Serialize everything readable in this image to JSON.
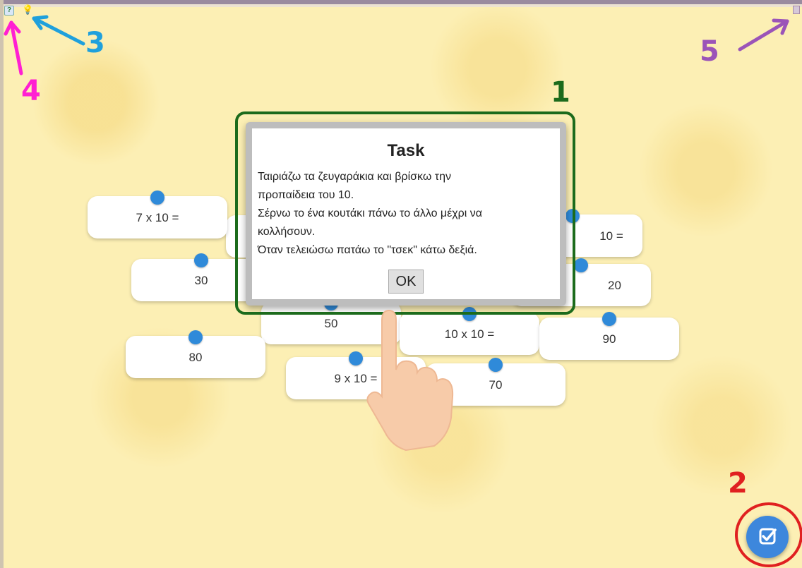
{
  "app": {
    "toolbar_icons": [
      "question-mark-icon",
      "lightbulb-icon"
    ],
    "help_glyph": "?",
    "hint_glyph": "💡"
  },
  "cards": [
    {
      "label": "7 x 10 ="
    },
    {
      "label": "30"
    },
    {
      "label": "10 ="
    },
    {
      "label": "20"
    },
    {
      "label": "50"
    },
    {
      "label": "10 x 10 ="
    },
    {
      "label": "90"
    },
    {
      "label": "80"
    },
    {
      "label": "9 x 10 ="
    },
    {
      "label": "70"
    }
  ],
  "modal": {
    "title": "Task",
    "lines": [
      "Ταιριάζω τα ζευγαράκια και βρίσκω την",
      "προπαίδεια του 10.",
      "Σέρνω το ένα κουτάκι πάνω το άλλο μέχρι να",
      "κολλήσουν.",
      "Όταν τελειώσω πατάω το \"τσεκ\" κάτω δεξιά."
    ],
    "ok_label": "OK"
  },
  "check_button": {
    "icon": "checkbox-icon",
    "color": "#3d87dc"
  },
  "annotations": [
    {
      "label": "1",
      "color": "#1c6b1c"
    },
    {
      "label": "2",
      "color": "#e02020"
    },
    {
      "label": "3",
      "color": "#1fa0dc"
    },
    {
      "label": "4",
      "color": "#ff1fd2"
    },
    {
      "label": "5",
      "color": "#9b54b8"
    }
  ],
  "colors": {
    "background": "#fcefb4",
    "dot": "#2f8ad9",
    "card": "#ffffff"
  }
}
